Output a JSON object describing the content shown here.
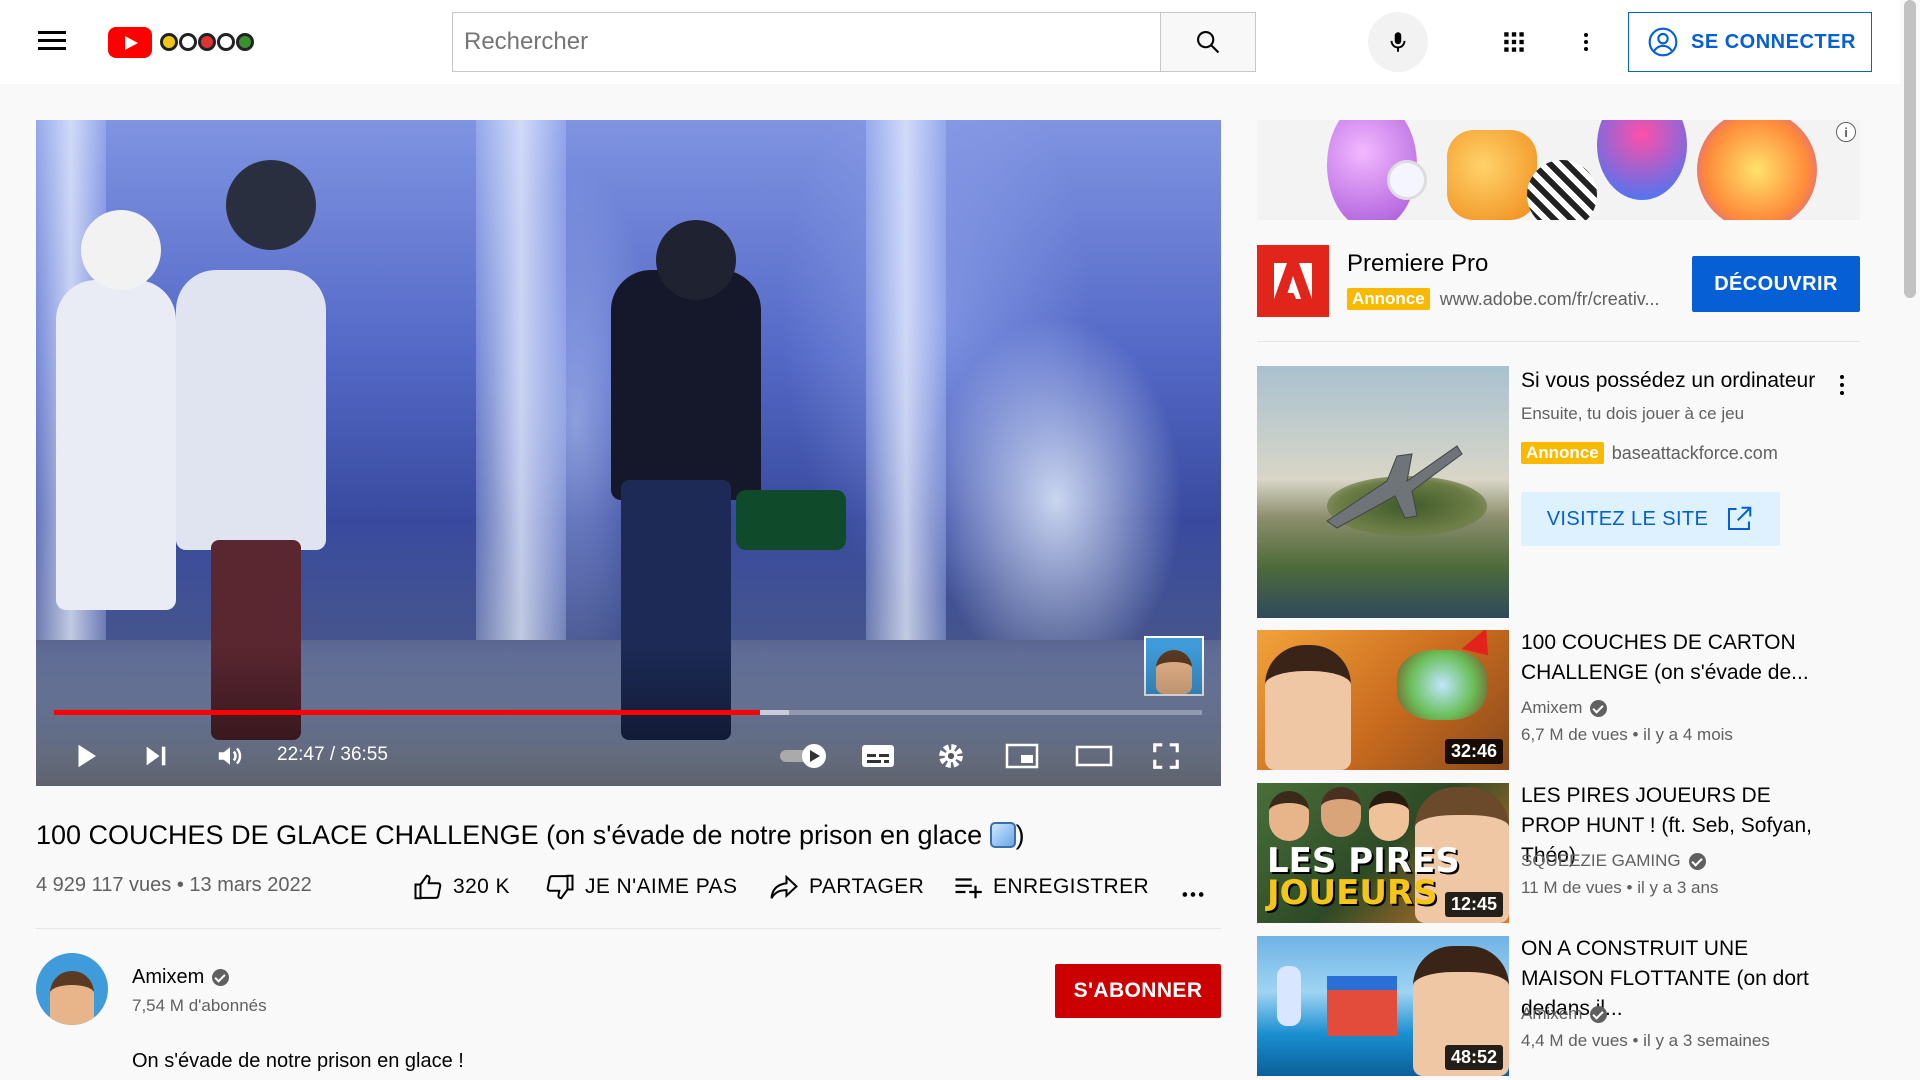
{
  "masthead": {
    "search_placeholder": "Rechercher",
    "signin_label": "SE CONNECTER",
    "icons": [
      "menu-icon",
      "youtube-logo",
      "search-icon",
      "mic-icon",
      "apps-icon",
      "more-vert-icon",
      "account-icon"
    ]
  },
  "player": {
    "time_display": "22:47 / 36:55",
    "progress_played": 0.615,
    "progress_loaded": 0.64,
    "icons": [
      "play-icon",
      "next-icon",
      "volume-icon",
      "autoplay-toggle-icon",
      "subtitles-icon",
      "settings-icon",
      "miniplayer-icon",
      "theater-icon",
      "fullscreen-icon"
    ]
  },
  "video": {
    "title": "100 COUCHES DE GLACE CHALLENGE (on s'évade de notre prison en glace",
    "title_close": ")",
    "views_date": "4 929 117 vues • 13 mars 2022",
    "like_count": "320 K",
    "dislike_label": "JE N'AIME PAS",
    "share_label": "PARTAGER",
    "save_label": "ENREGISTRER"
  },
  "owner": {
    "name": "Amixem",
    "subscribers": "7,54 M d'abonnés",
    "subscribe_label": "S'ABONNER",
    "description": "On s'évade de notre prison en glace !"
  },
  "sidebar": {
    "ad1": {
      "title": "Premiere Pro",
      "badge": "Annonce",
      "url": "www.adobe.com/fr/creativ...",
      "cta": "DÉCOUVRIR",
      "info": "i"
    },
    "ad2": {
      "title": "Si vous possédez un ordinateur",
      "subtitle": "Ensuite, tu dois jouer à ce jeu",
      "badge": "Annonce",
      "domain": "baseattackforce.com",
      "cta": "VISITEZ LE SITE"
    },
    "videos": [
      {
        "title": "100 COUCHES DE CARTON CHALLENGE (on s'évade de...",
        "channel": "Amixem",
        "meta": "6,7 M de vues • il y a 4 mois",
        "duration": "32:46"
      },
      {
        "title": "LES PIRES JOUEURS DE PROP HUNT ! (ft. Seb, Sofyan, Théo)",
        "channel": "SQUEEZIE GAMING",
        "meta": "11 M de vues • il y a 3 ans",
        "duration": "12:45",
        "thumb_text_1": "LES PIRES",
        "thumb_text_2": "JOUEURS"
      },
      {
        "title": "ON A CONSTRUIT UNE MAISON FLOTTANTE (on dort dedans il...",
        "channel": "Amixem",
        "meta": "4,4 M de vues • il y a 3 semaines",
        "duration": "48:52"
      }
    ]
  },
  "colors": {
    "accent_red": "#ff0000",
    "subscribe_red": "#cc0000",
    "link_blue": "#065fd4",
    "badge_yellow": "#f8b900"
  }
}
